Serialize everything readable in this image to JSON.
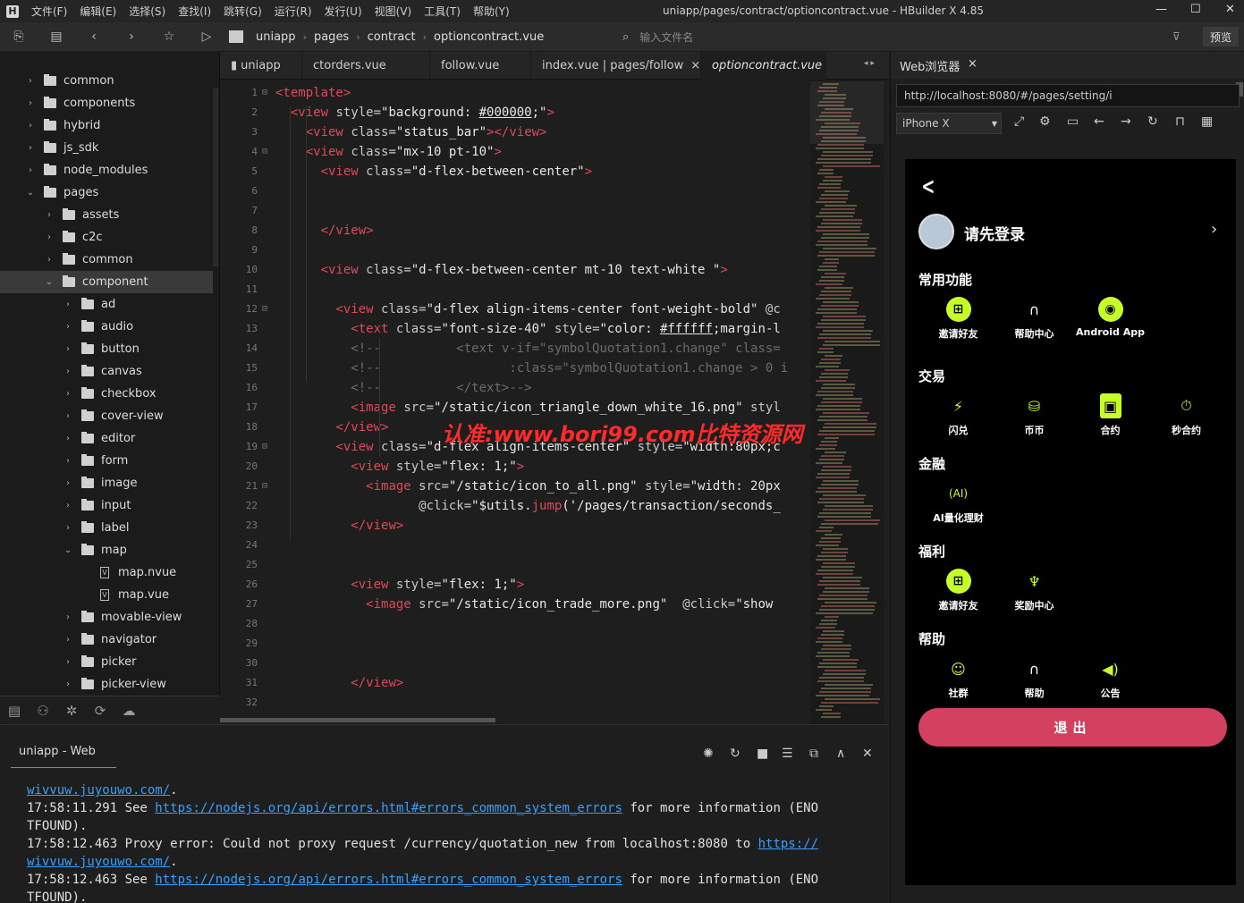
{
  "window": {
    "title": "uniapp/pages/contract/optioncontract.vue - HBuilder X 4.85",
    "menu": [
      "文件(F)",
      "编辑(E)",
      "选择(S)",
      "查找(I)",
      "跳转(G)",
      "运行(R)",
      "发行(U)",
      "视图(V)",
      "工具(T)",
      "帮助(Y)"
    ]
  },
  "toolbar": {
    "breadcrumb": [
      "uniapp",
      "pages",
      "contract",
      "optioncontract.vue"
    ],
    "file_search_placeholder": "输入文件名",
    "preview_label": "预览"
  },
  "sidebar": {
    "rows": [
      {
        "label": "common",
        "depth": 0,
        "type": "folder",
        "expanded": false
      },
      {
        "label": "components",
        "depth": 0,
        "type": "folder",
        "expanded": false
      },
      {
        "label": "hybrid",
        "depth": 0,
        "type": "folder",
        "expanded": false
      },
      {
        "label": "js_sdk",
        "depth": 0,
        "type": "folder",
        "expanded": false
      },
      {
        "label": "node_modules",
        "depth": 0,
        "type": "folder",
        "expanded": false
      },
      {
        "label": "pages",
        "depth": 0,
        "type": "folder",
        "expanded": true
      },
      {
        "label": "assets",
        "depth": 1,
        "type": "folder",
        "expanded": false
      },
      {
        "label": "c2c",
        "depth": 1,
        "type": "folder",
        "expanded": false
      },
      {
        "label": "common",
        "depth": 1,
        "type": "folder",
        "expanded": false
      },
      {
        "label": "component",
        "depth": 1,
        "type": "folder",
        "expanded": true,
        "selected": true
      },
      {
        "label": "ad",
        "depth": 2,
        "type": "folder",
        "expanded": false
      },
      {
        "label": "audio",
        "depth": 2,
        "type": "folder",
        "expanded": false
      },
      {
        "label": "button",
        "depth": 2,
        "type": "folder",
        "expanded": false
      },
      {
        "label": "canvas",
        "depth": 2,
        "type": "folder",
        "expanded": false
      },
      {
        "label": "checkbox",
        "depth": 2,
        "type": "folder",
        "expanded": false
      },
      {
        "label": "cover-view",
        "depth": 2,
        "type": "folder",
        "expanded": false
      },
      {
        "label": "editor",
        "depth": 2,
        "type": "folder",
        "expanded": false
      },
      {
        "label": "form",
        "depth": 2,
        "type": "folder",
        "expanded": false
      },
      {
        "label": "image",
        "depth": 2,
        "type": "folder",
        "expanded": false
      },
      {
        "label": "input",
        "depth": 2,
        "type": "folder",
        "expanded": false
      },
      {
        "label": "label",
        "depth": 2,
        "type": "folder",
        "expanded": false
      },
      {
        "label": "map",
        "depth": 2,
        "type": "folder",
        "expanded": true
      },
      {
        "label": "map.nvue",
        "depth": 3,
        "type": "file"
      },
      {
        "label": "map.vue",
        "depth": 3,
        "type": "file"
      },
      {
        "label": "movable-view",
        "depth": 2,
        "type": "folder",
        "expanded": false
      },
      {
        "label": "navigator",
        "depth": 2,
        "type": "folder",
        "expanded": false
      },
      {
        "label": "picker",
        "depth": 2,
        "type": "folder",
        "expanded": false
      },
      {
        "label": "picker-view",
        "depth": 2,
        "type": "folder",
        "expanded": false
      }
    ]
  },
  "editor": {
    "tabs": [
      {
        "label": "uniapp"
      },
      {
        "label": "ctorders.vue"
      },
      {
        "label": "follow.vue"
      },
      {
        "label": "index.vue | pages/follow",
        "close": "×"
      },
      {
        "label": "optioncontract.vue",
        "active": true
      }
    ],
    "lines": [
      {
        "n": "1",
        "fold": "⊟",
        "html": "<span class='tag'>&lt;template&gt;</span>"
      },
      {
        "n": "2",
        "html": "  <span class='tag'>&lt;view</span> <span class='attr'>style=</span><span class='str'>\"background: <u>#000000</u>;\"</span><span class='tag'>&gt;</span>"
      },
      {
        "n": "3",
        "html": "    <span class='tag'>&lt;view</span> <span class='attr'>class=</span><span class='str'>\"status_bar\"</span><span class='tag'>&gt;&lt;/view&gt;</span>"
      },
      {
        "n": "4",
        "fold": "⊟",
        "html": "    <span class='tag'>&lt;view</span> <span class='attr'>class=</span><span class='str'>\"mx-10 pt-10\"</span><span class='tag'>&gt;</span>"
      },
      {
        "n": "5",
        "html": "      <span class='tag'>&lt;view</span> <span class='attr'>class=</span><span class='str'>\"d-flex-between-center\"</span><span class='tag'>&gt;</span>"
      },
      {
        "n": "6",
        "html": ""
      },
      {
        "n": "7",
        "html": ""
      },
      {
        "n": "8",
        "html": "      <span class='tag'>&lt;/view&gt;</span>"
      },
      {
        "n": "9",
        "html": ""
      },
      {
        "n": "10",
        "html": "      <span class='tag'>&lt;view</span> <span class='attr'>class=</span><span class='str'>\"d-flex-between-center mt-10 text-white \"</span><span class='tag'>&gt;</span>"
      },
      {
        "n": "11",
        "html": ""
      },
      {
        "n": "12",
        "fold": "⊟",
        "html": "        <span class='tag'>&lt;view</span> <span class='attr'>class=</span><span class='str'>\"d-flex align-items-center font-weight-bold\"</span> <span class='attr'>@c</span>"
      },
      {
        "n": "13",
        "html": "          <span class='tag'>&lt;text</span> <span class='attr'>class=</span><span class='str'>\"font-size-40\"</span> <span class='attr'>style=</span><span class='str'>\"color: <u>#ffffff</u>;margin-l</span>"
      },
      {
        "n": "14",
        "html": "          <span class='cmt'>&lt;!--          &lt;text v-if=\"symbolQuotation1.change\" class=</span>"
      },
      {
        "n": "15",
        "html": "          <span class='cmt'>&lt;!--                 :class=\"symbolQuotation1.change &gt; 0 i</span>"
      },
      {
        "n": "16",
        "html": "          <span class='cmt'>&lt;!--          &lt;/text&gt;--&gt;</span>"
      },
      {
        "n": "17",
        "html": "          <span class='tag'>&lt;image</span> <span class='attr'>src=</span><span class='str'>\"/static/icon_triangle_down_white_16.png\"</span> <span class='attr'>styl</span>"
      },
      {
        "n": "18",
        "html": "        <span class='tag'>&lt;/view&gt;</span>"
      },
      {
        "n": "19",
        "fold": "⊟",
        "html": "        <span class='tag'>&lt;view</span> <span class='attr'>class=</span><span class='str'>\"d-flex align-items-center\"</span> <span class='attr'>style=</span><span class='str'>\"width:80px;c</span>"
      },
      {
        "n": "20",
        "html": "          <span class='tag'>&lt;view</span> <span class='attr'>style=</span><span class='str'>\"flex: 1;\"</span><span class='tag'>&gt;</span>"
      },
      {
        "n": "21",
        "fold": "⊟",
        "html": "            <span class='tag'>&lt;image</span> <span class='attr'>src=</span><span class='str'>\"/static/icon_to_all.png\"</span> <span class='attr'>style=</span><span class='str'>\"width: 20px</span>"
      },
      {
        "n": "22",
        "html": "                   <span class='attr'>@click=</span><span class='str'>\"$utils.<span class='tag'>jump</span>('/pages/transaction/seconds_</span>"
      },
      {
        "n": "23",
        "html": "          <span class='tag'>&lt;/view&gt;</span>"
      },
      {
        "n": "24",
        "html": ""
      },
      {
        "n": "25",
        "html": ""
      },
      {
        "n": "26",
        "html": "          <span class='tag'>&lt;view</span> <span class='attr'>style=</span><span class='str'>\"flex: 1;\"</span><span class='tag'>&gt;</span>"
      },
      {
        "n": "27",
        "html": "            <span class='tag'>&lt;image</span> <span class='attr'>src=</span><span class='str'>\"/static/icon_trade_more.png\"</span>  <span class='attr'>@click=</span><span class='str'>\"show</span>"
      },
      {
        "n": "28",
        "html": ""
      },
      {
        "n": "29",
        "html": ""
      },
      {
        "n": "30",
        "html": ""
      },
      {
        "n": "31",
        "html": "          <span class='tag'>&lt;/view&gt;</span>"
      },
      {
        "n": "32",
        "html": ""
      }
    ],
    "watermark": "认准:www.bori99.com比特资源网"
  },
  "console": {
    "tab_label": "uniapp - Web",
    "lines": [
      [
        {
          "t": "wivvuw.juyouwo.com/",
          "link": true
        },
        {
          "t": "."
        }
      ],
      [
        {
          "t": "17:58:11.291 See "
        },
        {
          "t": "https://nodejs.org/api/errors.html#errors_common_system_errors",
          "link": true
        },
        {
          "t": " for more information (ENO"
        }
      ],
      [
        {
          "t": "TFOUND)."
        }
      ],
      [
        {
          "t": "17:58:12.463 Proxy error: Could not proxy request /currency/quotation_new from localhost:8080 to "
        },
        {
          "t": "https://",
          "link": true
        }
      ],
      [
        {
          "t": "wivvuw.juyouwo.com/",
          "link": true
        },
        {
          "t": "."
        }
      ],
      [
        {
          "t": "17:58:12.463 See "
        },
        {
          "t": "https://nodejs.org/api/errors.html#errors_common_system_errors",
          "link": true
        },
        {
          "t": " for more information (ENO"
        }
      ],
      [
        {
          "t": "TFOUND)."
        }
      ]
    ]
  },
  "browser": {
    "tab_label": "Web浏览器",
    "tab_close": "×",
    "url": "http://localhost:8080/#/pages/setting/i",
    "device": "iPhone X",
    "app": {
      "back": "<",
      "login_prompt": "请先登录",
      "sections": [
        {
          "title": "常用功能",
          "items": [
            {
              "label": "邀请好友",
              "icon": "gift-icon",
              "glyph": "⊞",
              "style": "filled"
            },
            {
              "label": "帮助中心",
              "icon": "headphones-icon",
              "glyph": "∩",
              "style": "white"
            },
            {
              "label": "Android App",
              "icon": "android-icon",
              "glyph": "◉",
              "style": "filled"
            }
          ]
        },
        {
          "title": "交易",
          "items": [
            {
              "label": "闪兑",
              "icon": "flash-exchange-icon",
              "glyph": "⚡",
              "style": "line"
            },
            {
              "label": "币币",
              "icon": "coins-icon",
              "glyph": "⛁",
              "style": "line"
            },
            {
              "label": "合约",
              "icon": "contract-icon",
              "glyph": "▣",
              "style": "filled-square"
            },
            {
              "label": "秒合约",
              "icon": "timer-icon",
              "glyph": "⏱",
              "style": "line"
            }
          ]
        },
        {
          "title": "金融",
          "items": [
            {
              "label": "AI量化理财",
              "icon": "ai-icon",
              "glyph": "(AI)",
              "style": "line"
            }
          ]
        },
        {
          "title": "福利",
          "items": [
            {
              "label": "邀请好友",
              "icon": "gift-icon",
              "glyph": "⊞",
              "style": "filled"
            },
            {
              "label": "奖励中心",
              "icon": "trophy-icon",
              "glyph": "♆",
              "style": "line"
            }
          ]
        },
        {
          "title": "帮助",
          "items": [
            {
              "label": "社群",
              "icon": "community-icon",
              "glyph": "☺",
              "style": "line"
            },
            {
              "label": "帮助",
              "icon": "headphones-icon",
              "glyph": "∩",
              "style": "white"
            },
            {
              "label": "公告",
              "icon": "megaphone-icon",
              "glyph": "◀)",
              "style": "line"
            }
          ]
        }
      ],
      "logout_label": "退出"
    }
  },
  "colors": {
    "accent": "#c6ff27",
    "logout": "#d4405f",
    "tag": "#e0485c",
    "link": "#3aa0ff"
  }
}
